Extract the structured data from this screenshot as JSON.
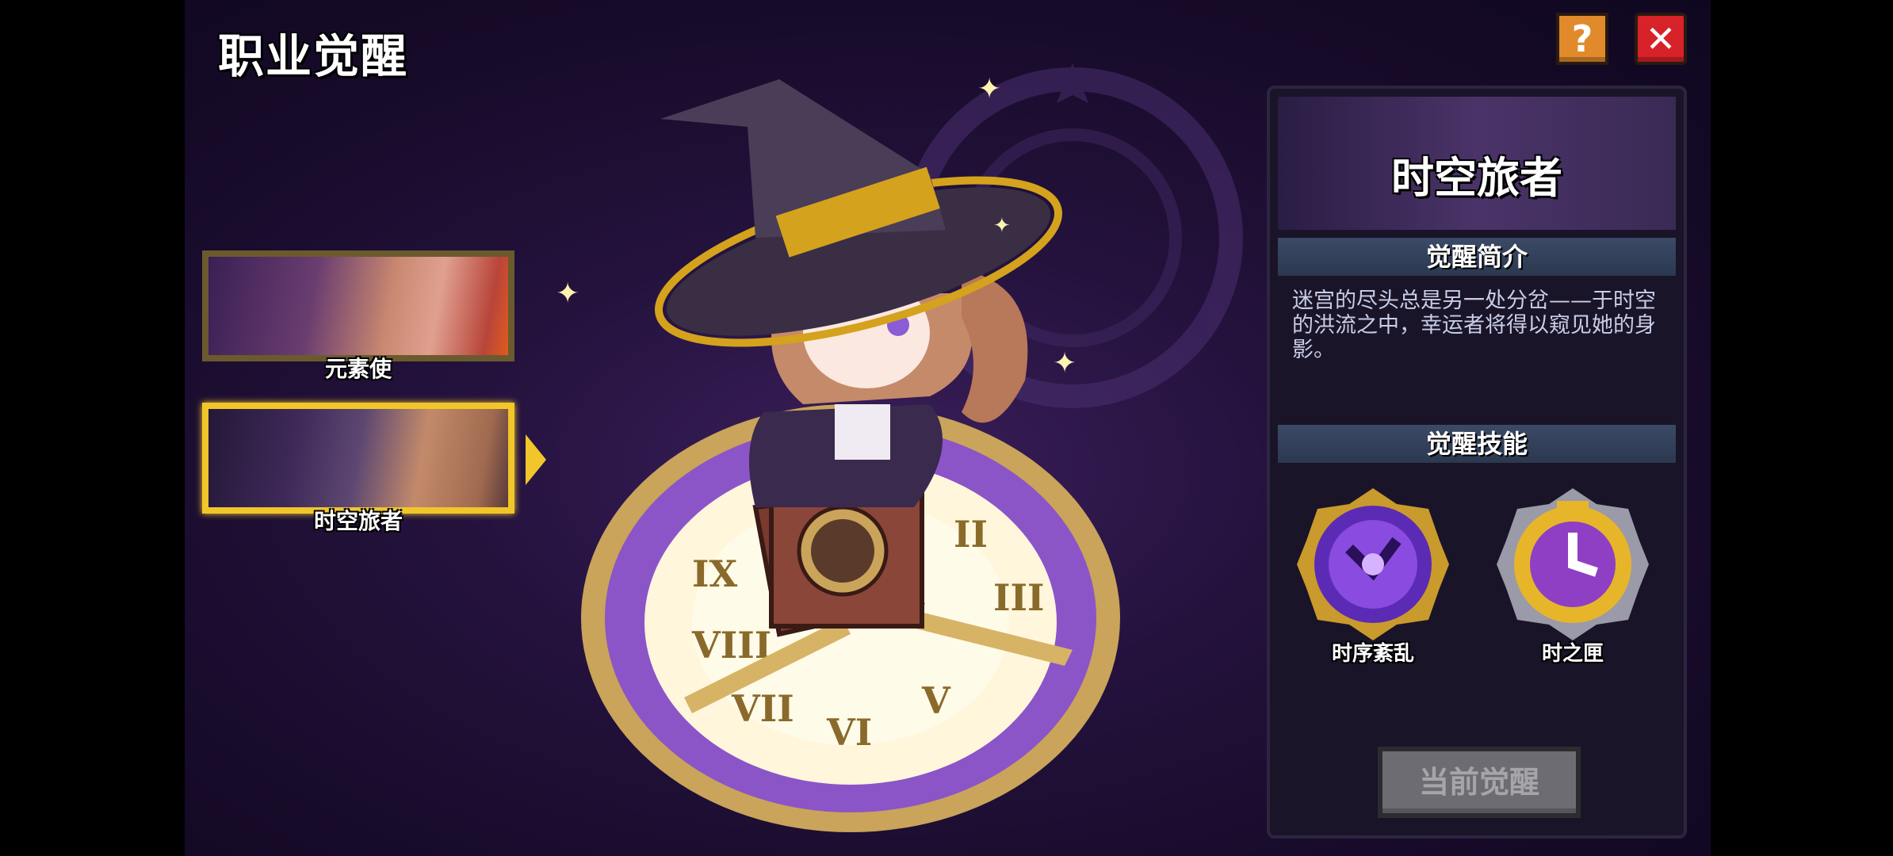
{
  "screen_title": "职业觉醒",
  "top_buttons": {
    "help_label": "?",
    "close_label": "✕"
  },
  "classes": [
    {
      "label": "元素使",
      "selected": false
    },
    {
      "label": "时空旅者",
      "selected": true
    }
  ],
  "panel": {
    "name": "时空旅者",
    "intro_title": "觉醒简介",
    "intro_text": "迷宫的尽头总是另一处分岔——于时空的洪流之中，幸运者将得以窥见她的身影。",
    "skills_title": "觉醒技能",
    "skills": [
      {
        "label": "时序紊乱",
        "icon": "purple-clock-orb-icon"
      },
      {
        "label": "时之匣",
        "icon": "golden-clock-icon"
      }
    ],
    "current_button": "当前觉醒"
  },
  "colors": {
    "accent_gold": "#f1c62a",
    "close_red": "#d8222a",
    "help_orange": "#e08a2c",
    "background_purple": "#24123d"
  }
}
